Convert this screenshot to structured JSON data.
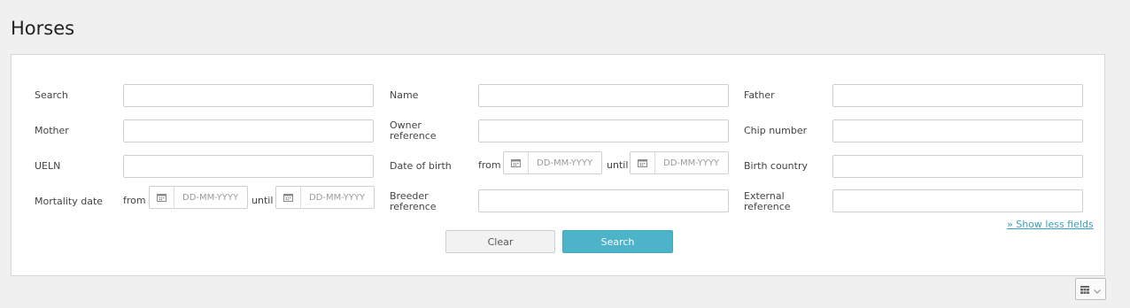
{
  "page": {
    "title": "Horses"
  },
  "filters": {
    "search": {
      "label": "Search",
      "value": ""
    },
    "name": {
      "label": "Name",
      "value": ""
    },
    "father": {
      "label": "Father",
      "value": ""
    },
    "mother": {
      "label": "Mother",
      "value": ""
    },
    "owner_reference": {
      "label_line1": "Owner",
      "label_line2": "reference",
      "value": ""
    },
    "chip_number": {
      "label": "Chip number",
      "value": ""
    },
    "ueln": {
      "label": "UELN",
      "value": ""
    },
    "date_of_birth": {
      "label": "Date of birth",
      "from_label": "from",
      "until_label": "until",
      "from_placeholder": "DD-MM-YYYY",
      "until_placeholder": "DD-MM-YYYY"
    },
    "birth_country": {
      "label": "Birth country",
      "value": ""
    },
    "mortality_date": {
      "label": "Mortality date",
      "from_label": "from",
      "until_label": "until",
      "from_placeholder": "DD-MM-YYYY",
      "until_placeholder": "DD-MM-YYYY"
    },
    "breeder_reference": {
      "label_line1": "Breeder",
      "label_line2": "reference",
      "value": ""
    },
    "external_reference": {
      "label_line1": "External",
      "label_line2": "reference",
      "value": ""
    }
  },
  "actions": {
    "show_less_label": "» Show less fields",
    "clear_label": "Clear",
    "search_label": "Search"
  },
  "colors": {
    "accent": "#4db3c8",
    "link": "#3a9fc0",
    "background": "#f0f0f0"
  },
  "icons": {
    "calendar": "calendar-icon",
    "grid_view": "grid-view-icon",
    "chevron": "chevron-down-icon"
  }
}
